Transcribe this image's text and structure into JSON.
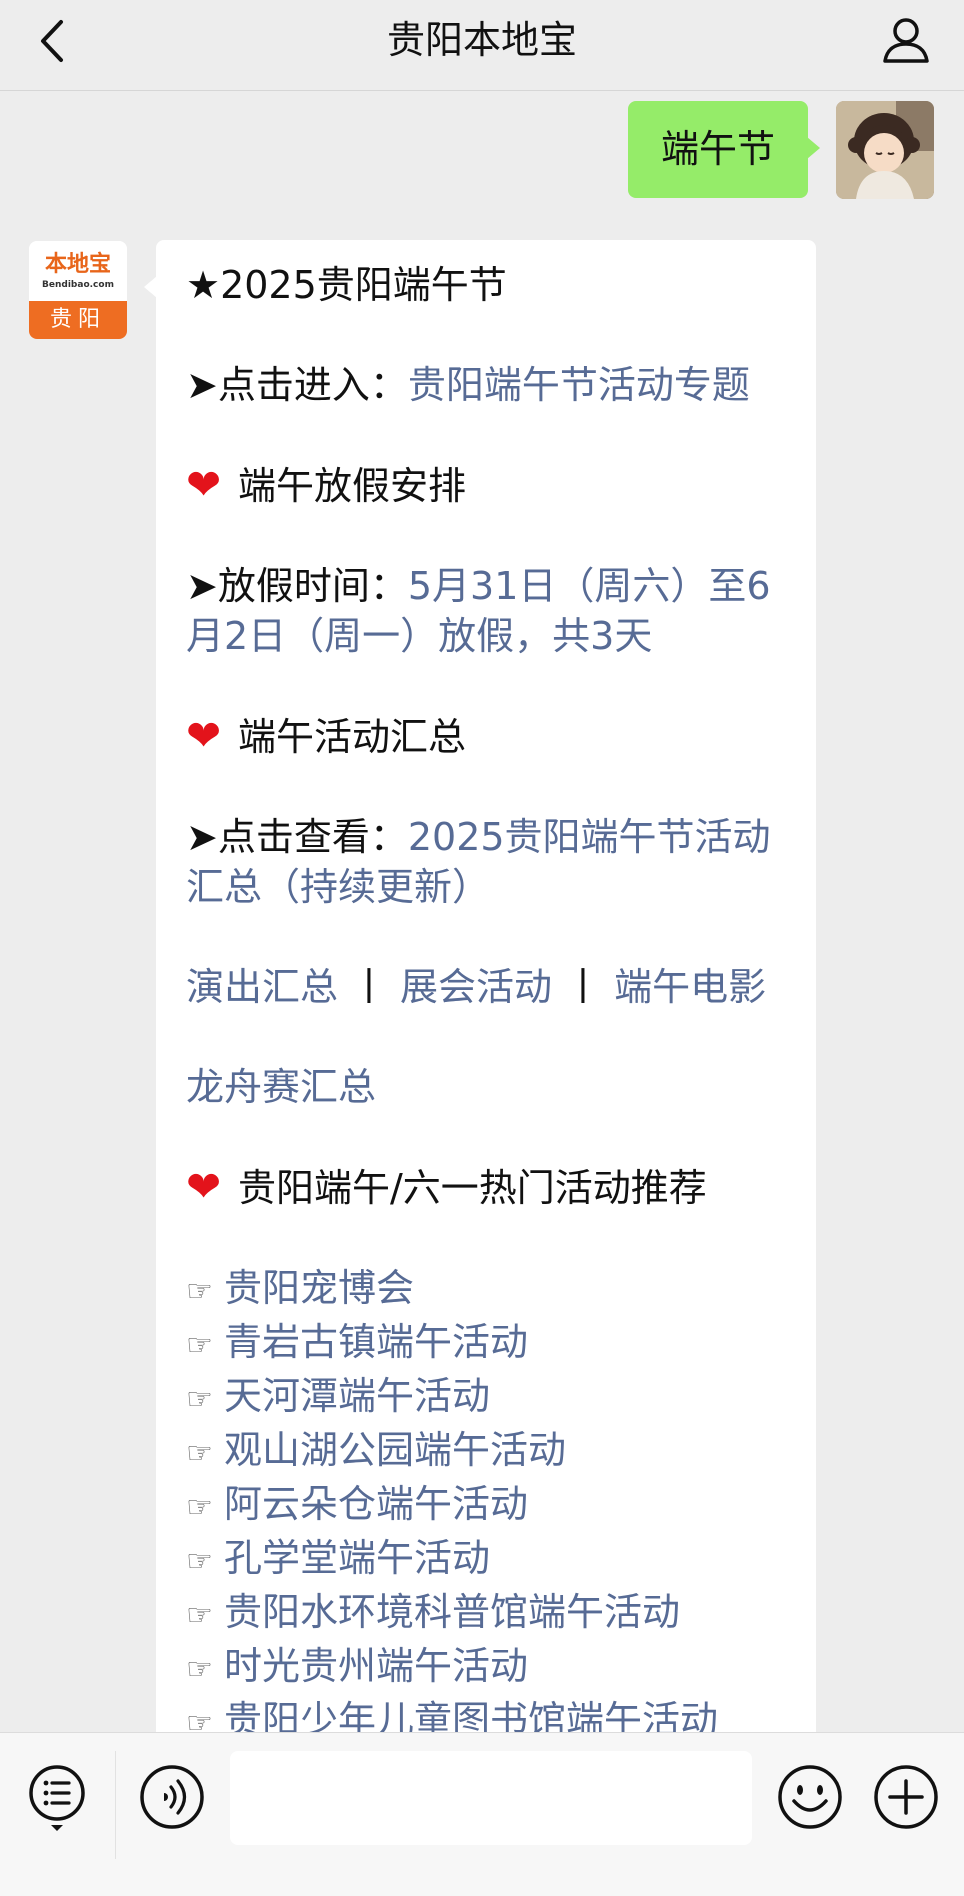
{
  "header": {
    "title": "贵阳本地宝"
  },
  "chat": {
    "outgoing": {
      "text": "端午节"
    },
    "incoming": {
      "avatar": {
        "logo": "本地宝",
        "subtext": "Bendibao.com",
        "city": "贵阳"
      },
      "lines": {
        "title": "★2025贵阳端午节",
        "enter_prefix": "➤点击进入：",
        "enter_link": "贵阳端午节活动专题",
        "holiday_heading": "端午放假安排",
        "holiday_prefix": "➤放假时间：",
        "holiday_link": "5月31日（周六）至6月2日（周一）放假，共3天",
        "events_heading": "端午活动汇总",
        "view_prefix": "➤点击查看：",
        "view_link": "2025贵阳端午节活动汇总（持续更新）",
        "cat_1": "演出汇总",
        "cat_sep": "丨",
        "cat_2": "展会活动",
        "cat_3": "端午电影",
        "cat_4": "龙舟赛汇总",
        "recommend_heading": "贵阳端午/六一热门活动推荐"
      },
      "hand_icon": "☞",
      "recommendations": [
        "贵阳宠博会",
        "青岩古镇端午活动",
        "天河潭端午活动",
        "观山湖公园端午活动",
        "阿云朵仓端午活动",
        "孔学堂端午活动",
        "贵阳水环境科普馆端午活动",
        "时光贵州端午活动",
        "贵阳少年儿童图书馆端午活动"
      ]
    }
  },
  "icons": {
    "back": "chevron-left-icon",
    "profile": "person-icon",
    "menu": "list-menu-icon",
    "voice": "voice-icon",
    "emoji": "smiley-icon",
    "plus": "plus-icon"
  },
  "colors": {
    "link": "#576b95",
    "outgoing_bubble": "#95ec69",
    "heart": "#e3131b",
    "brand_orange": "#ee6d22"
  }
}
